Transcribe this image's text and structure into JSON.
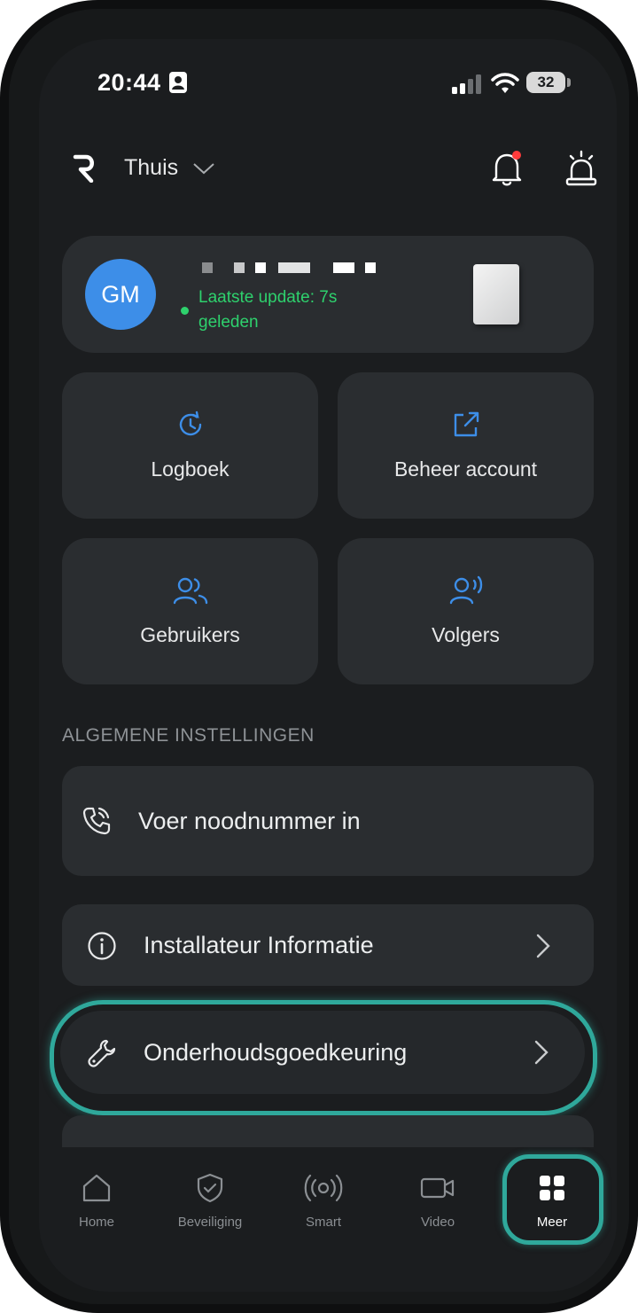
{
  "status_bar": {
    "time": "20:44",
    "battery": "32"
  },
  "header": {
    "location": "Thuis"
  },
  "device": {
    "avatar_initials": "GM",
    "status_text_line1": "Laatste update: 7s",
    "status_text_line2": "geleden"
  },
  "tiles": [
    {
      "label": "Logboek",
      "icon": "history-icon"
    },
    {
      "label": "Beheer account",
      "icon": "external-link-icon"
    },
    {
      "label": "Gebruikers",
      "icon": "users-icon"
    },
    {
      "label": "Volgers",
      "icon": "follower-icon"
    }
  ],
  "section_title": "ALGEMENE INSTELLINGEN",
  "settings": [
    {
      "label": "Voer noodnummer in",
      "icon": "phone-icon"
    },
    {
      "label": "Installateur Informatie",
      "icon": "info-icon"
    },
    {
      "label": "Onderhoudsgoedkeuring",
      "icon": "wrench-icon"
    }
  ],
  "tabs": [
    {
      "label": "Home",
      "icon": "home-icon"
    },
    {
      "label": "Beveiliging",
      "icon": "shield-icon"
    },
    {
      "label": "Smart",
      "icon": "smart-icon"
    },
    {
      "label": "Video",
      "icon": "video-icon"
    },
    {
      "label": "Meer",
      "icon": "grid-icon"
    }
  ],
  "colors": {
    "accent_blue": "#3d8ee8",
    "status_green": "#2ed16d",
    "highlight_teal": "#2fa89b",
    "notification_red": "#ff3b3b"
  }
}
